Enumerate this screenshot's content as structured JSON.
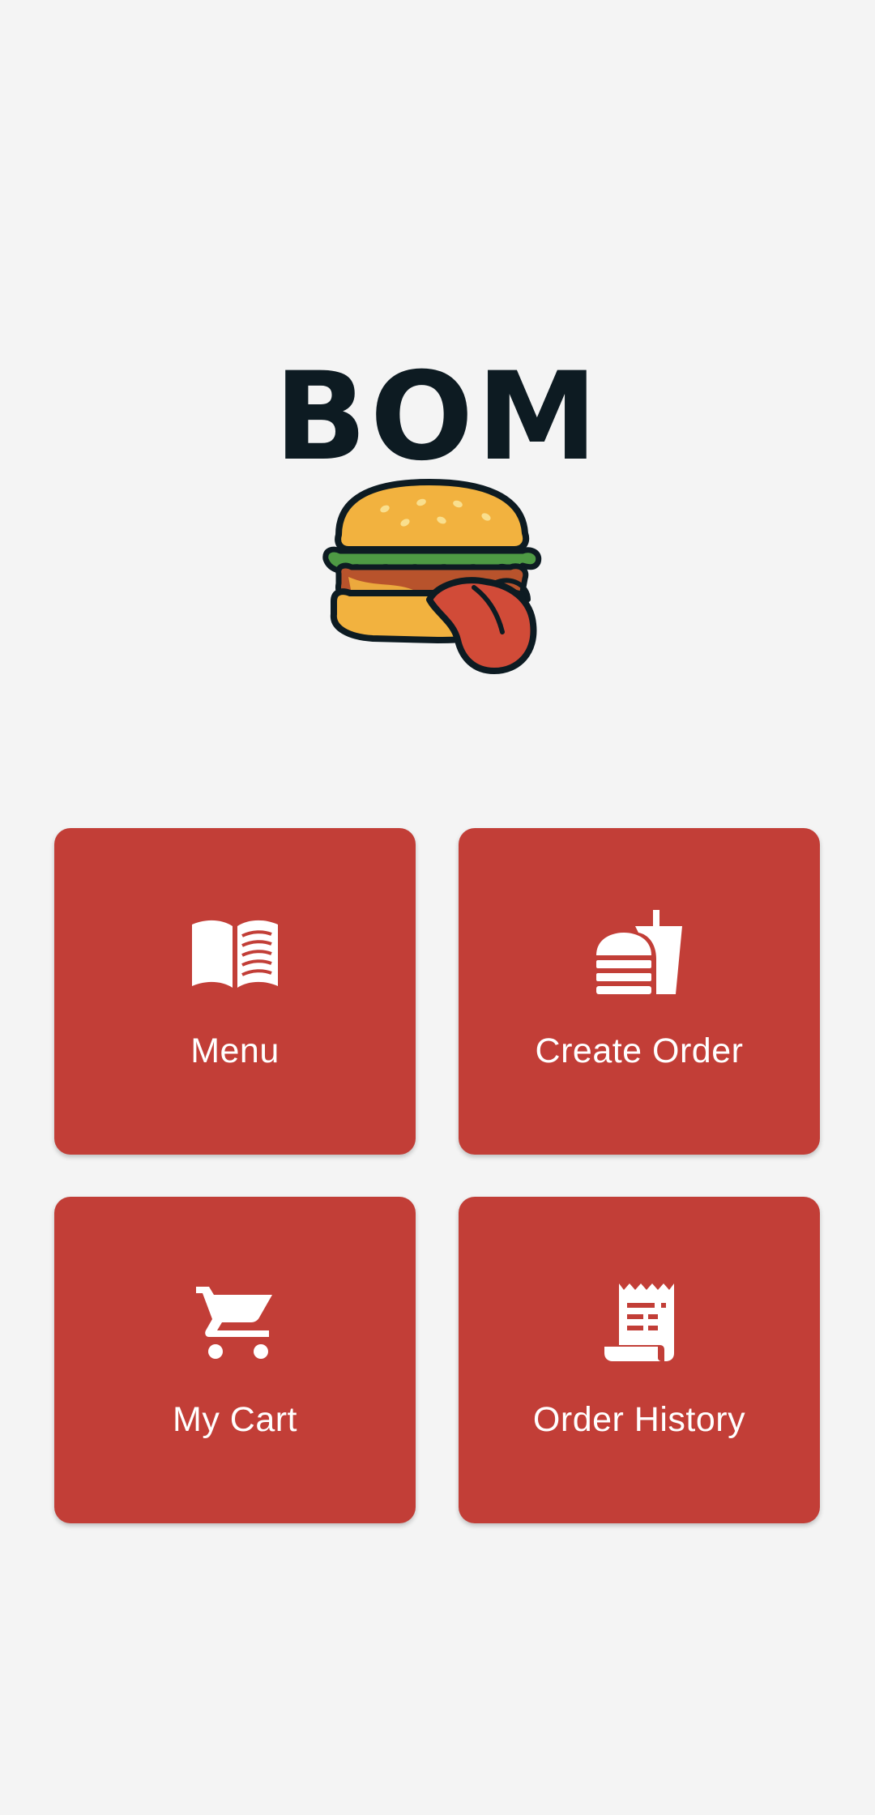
{
  "app": {
    "logo_text": "BOM"
  },
  "tiles": [
    {
      "id": "menu",
      "label": "Menu",
      "icon": "open-book-icon"
    },
    {
      "id": "create_order",
      "label": "Create Order",
      "icon": "burger-drink-icon"
    },
    {
      "id": "my_cart",
      "label": "My Cart",
      "icon": "shopping-cart-icon"
    },
    {
      "id": "order_history",
      "label": "Order History",
      "icon": "receipt-icon"
    }
  ],
  "colors": {
    "background": "#f4f4f4",
    "tile": "#c23e37",
    "tile_text": "#ffffff",
    "logo_text": "#0d1b22",
    "bun": "#f2b23f",
    "lettuce": "#4e9a44",
    "patty": "#b8532c",
    "tongue": "#d14b38"
  }
}
